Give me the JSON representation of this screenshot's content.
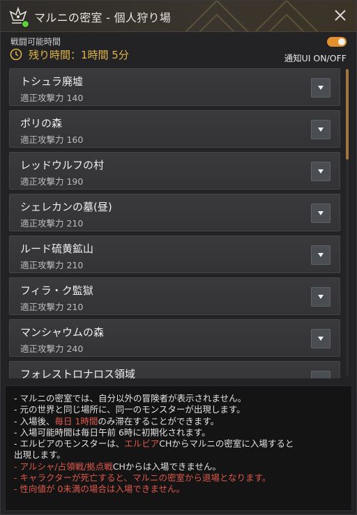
{
  "window": {
    "title": "マルニの密室 - 個人狩り場"
  },
  "header": {
    "battle_time_label": "戦闘可能時間",
    "remaining_time": "残り時間：1時間 5分",
    "notify_label": "通知UI ON/OFF",
    "notify_on": true
  },
  "zones": [
    {
      "name": "トシュラ廃墟",
      "power": "適正攻撃力 140"
    },
    {
      "name": "ポリの森",
      "power": "適正攻撃力 160"
    },
    {
      "name": "レッドウルフの村",
      "power": "適正攻撃力 190"
    },
    {
      "name": "シェレカンの墓(昼)",
      "power": "適正攻撃力 210"
    },
    {
      "name": "ルード硫黄鉱山",
      "power": "適正攻撃力 210"
    },
    {
      "name": "フィラ・ク監獄",
      "power": "適正攻撃力 210"
    },
    {
      "name": "マンシャウムの森",
      "power": "適正攻撃力 240"
    },
    {
      "name": "フォレストロナロス領域",
      "power": ""
    }
  ],
  "notes": {
    "line1": "- マルニの密室では、自分以外の冒険者が表示されません。",
    "line2": "- 元の世界と同じ場所に、同一のモンスターが出現します。",
    "line3_pre": "- 入場後、",
    "line3_red": "毎日 1時間",
    "line3_post": "のみ滞在することができます。",
    "line4": "- 入場可能時間は毎日午前 6時に初期化されます。",
    "line5_pre": "- エルビアのモンスターは、",
    "line5_red": "エルビア",
    "line5_post": "CHからマルニの密室に入場すると",
    "line6": "出現します。",
    "line7_red": "- アルシャ/占領戦/拠点戦",
    "line7_post": "CHからは入場できません。",
    "line8": "- キャラクターが死亡すると、マルニの密室から退場となります。",
    "line9": "- 性向値が 0未満の場合は入場できません。"
  },
  "colors": {
    "accent": "#e0b548",
    "toggle": "#e2912e",
    "warning": "#e0584a"
  },
  "icons": {
    "title": "crown-emblem-icon",
    "clock": "clock-icon",
    "close": "close-icon",
    "expand": "chevron-down-icon"
  }
}
